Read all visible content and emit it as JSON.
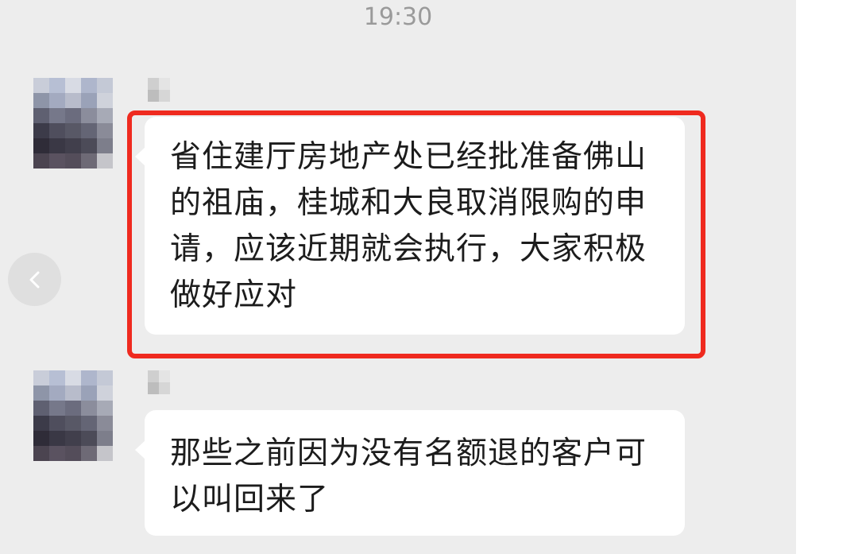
{
  "chat": {
    "timestamp": "19:30",
    "messages": [
      {
        "text": "省住建厅房地产处已经批准备佛山的祖庙，桂城和大良取消限购的申请，应该近期就会执行，大家积极做好应对",
        "highlighted": true
      },
      {
        "text": "那些之前因为没有名额退的客户可以叫回来了",
        "highlighted": false
      }
    ]
  },
  "colors": {
    "background": "#ededed",
    "bubble": "#ffffff",
    "highlight_border": "#ef2a1f",
    "timestamp_text": "#9a9a9a"
  },
  "icons": {
    "back_button": "chevron-left-icon"
  }
}
